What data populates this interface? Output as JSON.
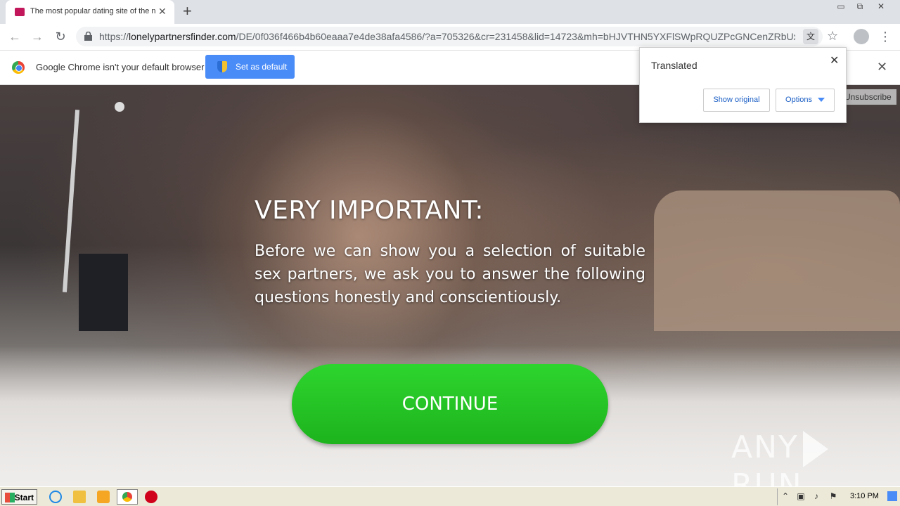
{
  "browser": {
    "tab_title": "The most popular dating site of the n",
    "tab_close": "✕",
    "new_tab": "+",
    "url_host": "lonelypartnersfinder.com",
    "url_prefix": "https://",
    "url_path": "/DE/0f036f466b4b60eaaa7e4de38afa4586/?a=705326&cr=231458&lid=14723&mh=bHJVTHN5YXFlSWpRQUZPcGNCenZRbUx...",
    "window_buttons": [
      "▭",
      "⧉",
      "✕"
    ]
  },
  "infobar": {
    "message": "Google Chrome isn't your default browser",
    "set_default_label": "Set as default",
    "close": "✕"
  },
  "translate_popup": {
    "title": "Translated",
    "show_original": "Show original",
    "options": "Options",
    "close": "✕"
  },
  "page": {
    "unsubscribe": "Unsubscribe",
    "headline": "VERY IMPORTANT:",
    "body": "Before we can show you a selection of suitable sex partners, we ask you to answer the following questions honestly and conscientiously.",
    "continue_label": "CONTINUE",
    "watermark_left": "ANY",
    "watermark_right": "RUN"
  },
  "taskbar": {
    "start_label": "Start",
    "clock": "3:10 PM"
  },
  "icons": [
    "lock-icon",
    "translate-icon",
    "star-icon",
    "profile-icon",
    "menu-icon",
    "back-icon",
    "forward-icon",
    "reload-icon",
    "chrome-logo-icon",
    "shield-icon",
    "ie-icon",
    "folder-icon",
    "media-player-icon",
    "chrome-taskbar-icon",
    "stop-icon"
  ],
  "colors": {
    "continue_button": "#22c022",
    "set_default_button": "#4a8cf7",
    "favicon": "#c2185b"
  }
}
